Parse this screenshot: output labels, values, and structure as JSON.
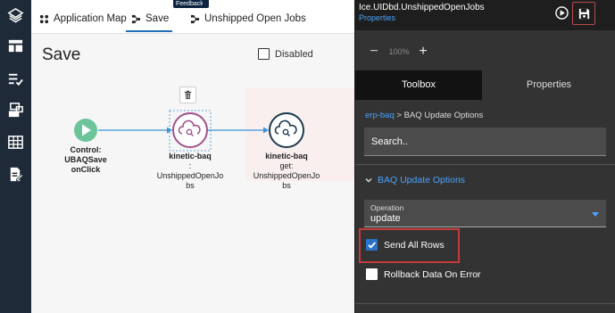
{
  "tabs": {
    "app_map": "Application Map",
    "save": "Save",
    "unshipped": "Unshipped Open Jobs"
  },
  "feedback_label": "Feedback",
  "canvas": {
    "title": "Save",
    "disabled_label": "Disabled"
  },
  "nodes": {
    "start": {
      "line1": "Control:",
      "line2": "UBAQSave",
      "line3": "onClick"
    },
    "selected": {
      "line1": "kinetic-baq",
      "line2": ":",
      "line3": "UnshippedOpenJo",
      "line4": "bs"
    },
    "target": {
      "line1": "kinetic-baq",
      "line2": "get:",
      "line3": "UnshippedOpenJo",
      "line4": "bs"
    }
  },
  "panel": {
    "title": "Ice.UIDbd.UnshippedOpenJobs",
    "subtitle": "Properties",
    "zoom": {
      "minus": "−",
      "value": "100%",
      "plus": "+"
    },
    "tab_toolbox": "Toolbox",
    "tab_properties": "Properties",
    "breadcrumb": {
      "link": "erp-baq",
      "sep": ">",
      "current": "BAQ Update Options"
    },
    "search_placeholder": "Search..",
    "section_title": "BAQ Update Options",
    "operation": {
      "label": "Operation",
      "value": "update"
    },
    "send_all_rows": {
      "label": "Send All Rows",
      "checked": true
    },
    "rollback": {
      "label": "Rollback Data On Error",
      "checked": false
    }
  },
  "colors": {
    "accent_blue": "#4aa3ff",
    "node_start": "#6cc49a",
    "node_selected": "#a0538c",
    "node_target": "#1d3b4f",
    "highlight_red": "#c63c3c"
  }
}
